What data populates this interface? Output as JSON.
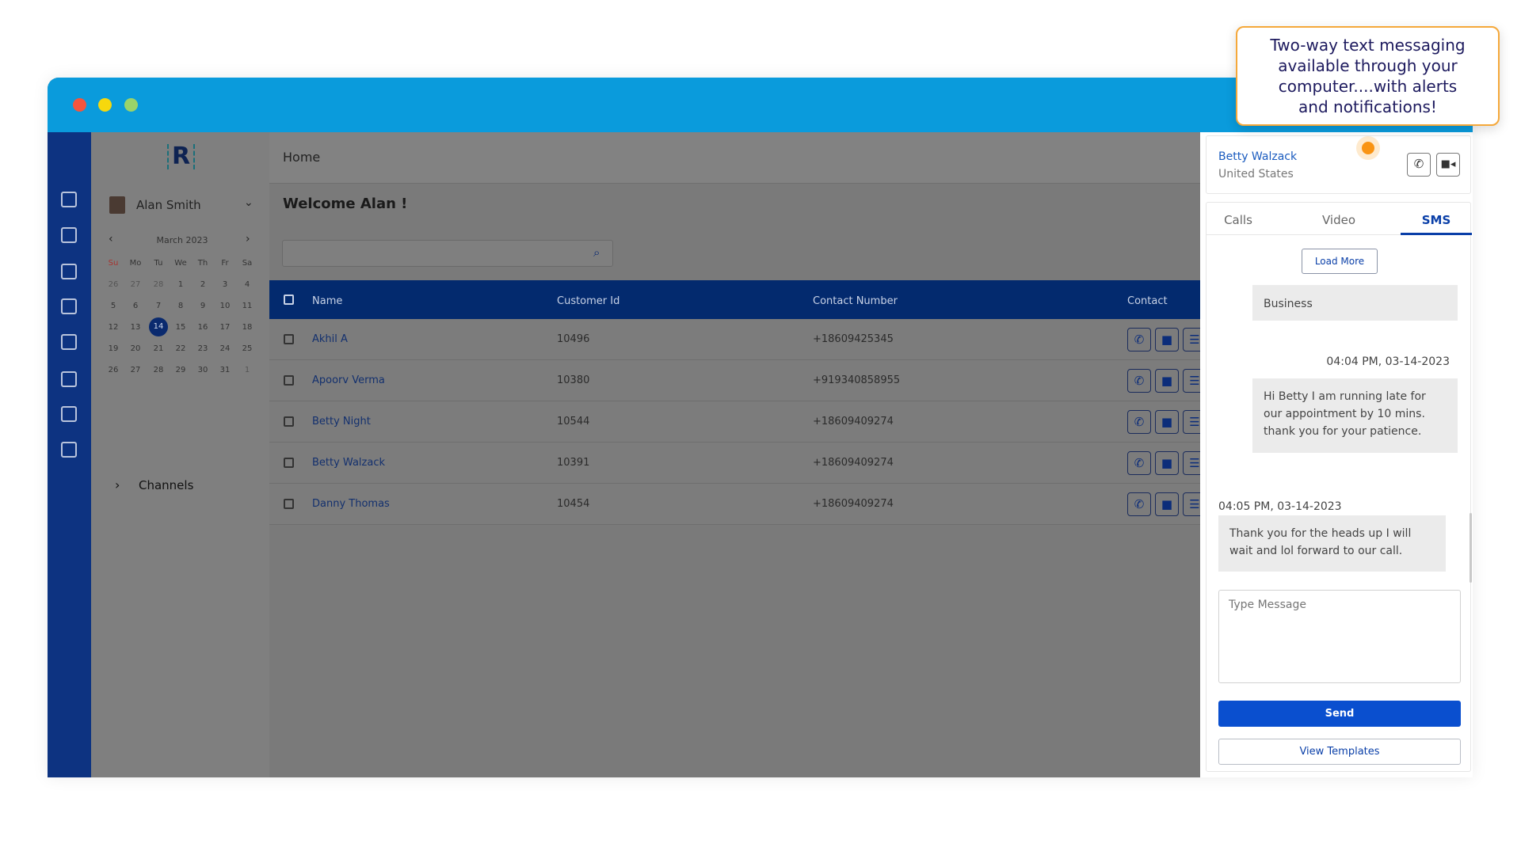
{
  "tooltip": {
    "text": "Two-way text messaging available through your computer....with alerts and notifications!"
  },
  "window": {
    "dots": [
      "#f4553d",
      "#f6d80d",
      "#9bd36a"
    ]
  },
  "nav": {
    "icons": [
      "dashboard-icon",
      "calendar-check-icon",
      "users-icon",
      "calendar-icon",
      "clipboard-check-icon",
      "user-settings-icon",
      "settings-icon",
      "reports-icon"
    ]
  },
  "left": {
    "user": "Alan Smith",
    "calendar": {
      "month": "March 2023",
      "weekdays": [
        "Su",
        "Mo",
        "Tu",
        "We",
        "Th",
        "Fr",
        "Sa"
      ],
      "weeks": [
        [
          "26",
          "27",
          "28",
          "1",
          "2",
          "3",
          "4"
        ],
        [
          "5",
          "6",
          "7",
          "8",
          "9",
          "10",
          "11"
        ],
        [
          "12",
          "13",
          "14",
          "15",
          "16",
          "17",
          "18"
        ],
        [
          "19",
          "20",
          "21",
          "22",
          "23",
          "24",
          "25"
        ],
        [
          "26",
          "27",
          "28",
          "29",
          "30",
          "31",
          "1"
        ]
      ],
      "selected": "14"
    },
    "channels": "Channels"
  },
  "main": {
    "breadcrumb": "Home",
    "welcome": "Welcome Alan !",
    "search_placeholder": "",
    "columns": [
      "Name",
      "Customer Id",
      "Contact Number",
      "Contact"
    ],
    "rows": [
      {
        "name": "Akhil A",
        "id": "10496",
        "phone": "+18609425345"
      },
      {
        "name": "Apoorv Verma",
        "id": "10380",
        "phone": "+919340858955"
      },
      {
        "name": "Betty Night",
        "id": "10544",
        "phone": "+18609409274"
      },
      {
        "name": "Betty Walzack",
        "id": "10391",
        "phone": "+18609409274"
      },
      {
        "name": "Danny Thomas",
        "id": "10454",
        "phone": "+18609409274"
      }
    ]
  },
  "chat": {
    "contact_name": "Betty Walzack",
    "contact_country": "United States",
    "tabs": [
      "Calls",
      "Video",
      "SMS"
    ],
    "active_tab": "SMS",
    "load_more": "Load More",
    "partial_message": "Business",
    "messages": [
      {
        "time": "04:04 PM, 03-14-2023",
        "text": "Hi Betty I am running late for our appointment by 10 mins. thank you for your patience.",
        "direction": "outgoing"
      },
      {
        "time": "04:05 PM, 03-14-2023",
        "text": "Thank you for the heads up I will wait and lol forward to our call.",
        "direction": "incoming"
      }
    ],
    "input_placeholder": "Type Message",
    "send": "Send",
    "view_templates": "View Templates",
    "accent": "#0a4fcf"
  }
}
